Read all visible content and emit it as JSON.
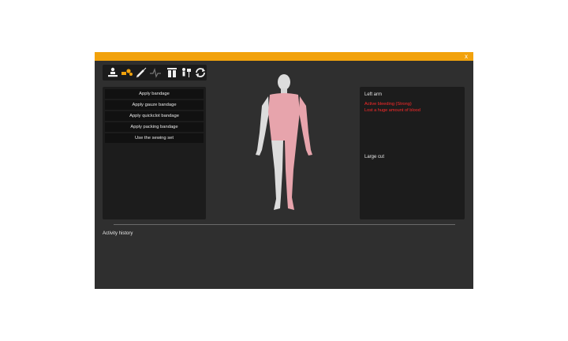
{
  "window": {
    "close_label": "x"
  },
  "toolbar": {
    "tools": [
      {
        "icon": "doctor-patient-icon",
        "active": false
      },
      {
        "icon": "bandage-icon",
        "active": true
      },
      {
        "icon": "syringe-icon",
        "active": false
      },
      {
        "icon": "heartbeat-icon",
        "active": false
      },
      {
        "icon": "vials-icon",
        "active": false
      },
      {
        "icon": "person-sign-icon",
        "active": false
      },
      {
        "icon": "refresh-icon",
        "active": false
      }
    ]
  },
  "actions": [
    "Apply bandage",
    "Apply gauze bandage",
    "Apply quickclot bandage",
    "Apply packing bandage",
    "Use the sewing set"
  ],
  "selected_part": {
    "name": "Left arm",
    "statuses": [
      "Active bleeding (Strong)",
      "Lost a huge amount of blood"
    ],
    "wounds": [
      "Large cut"
    ]
  },
  "history": {
    "label": "Activity history"
  },
  "colors": {
    "accent": "#f2a20c",
    "alert": "#ff2a2a",
    "injured": "#e7a4ac",
    "healthy": "#dcdcdc"
  }
}
